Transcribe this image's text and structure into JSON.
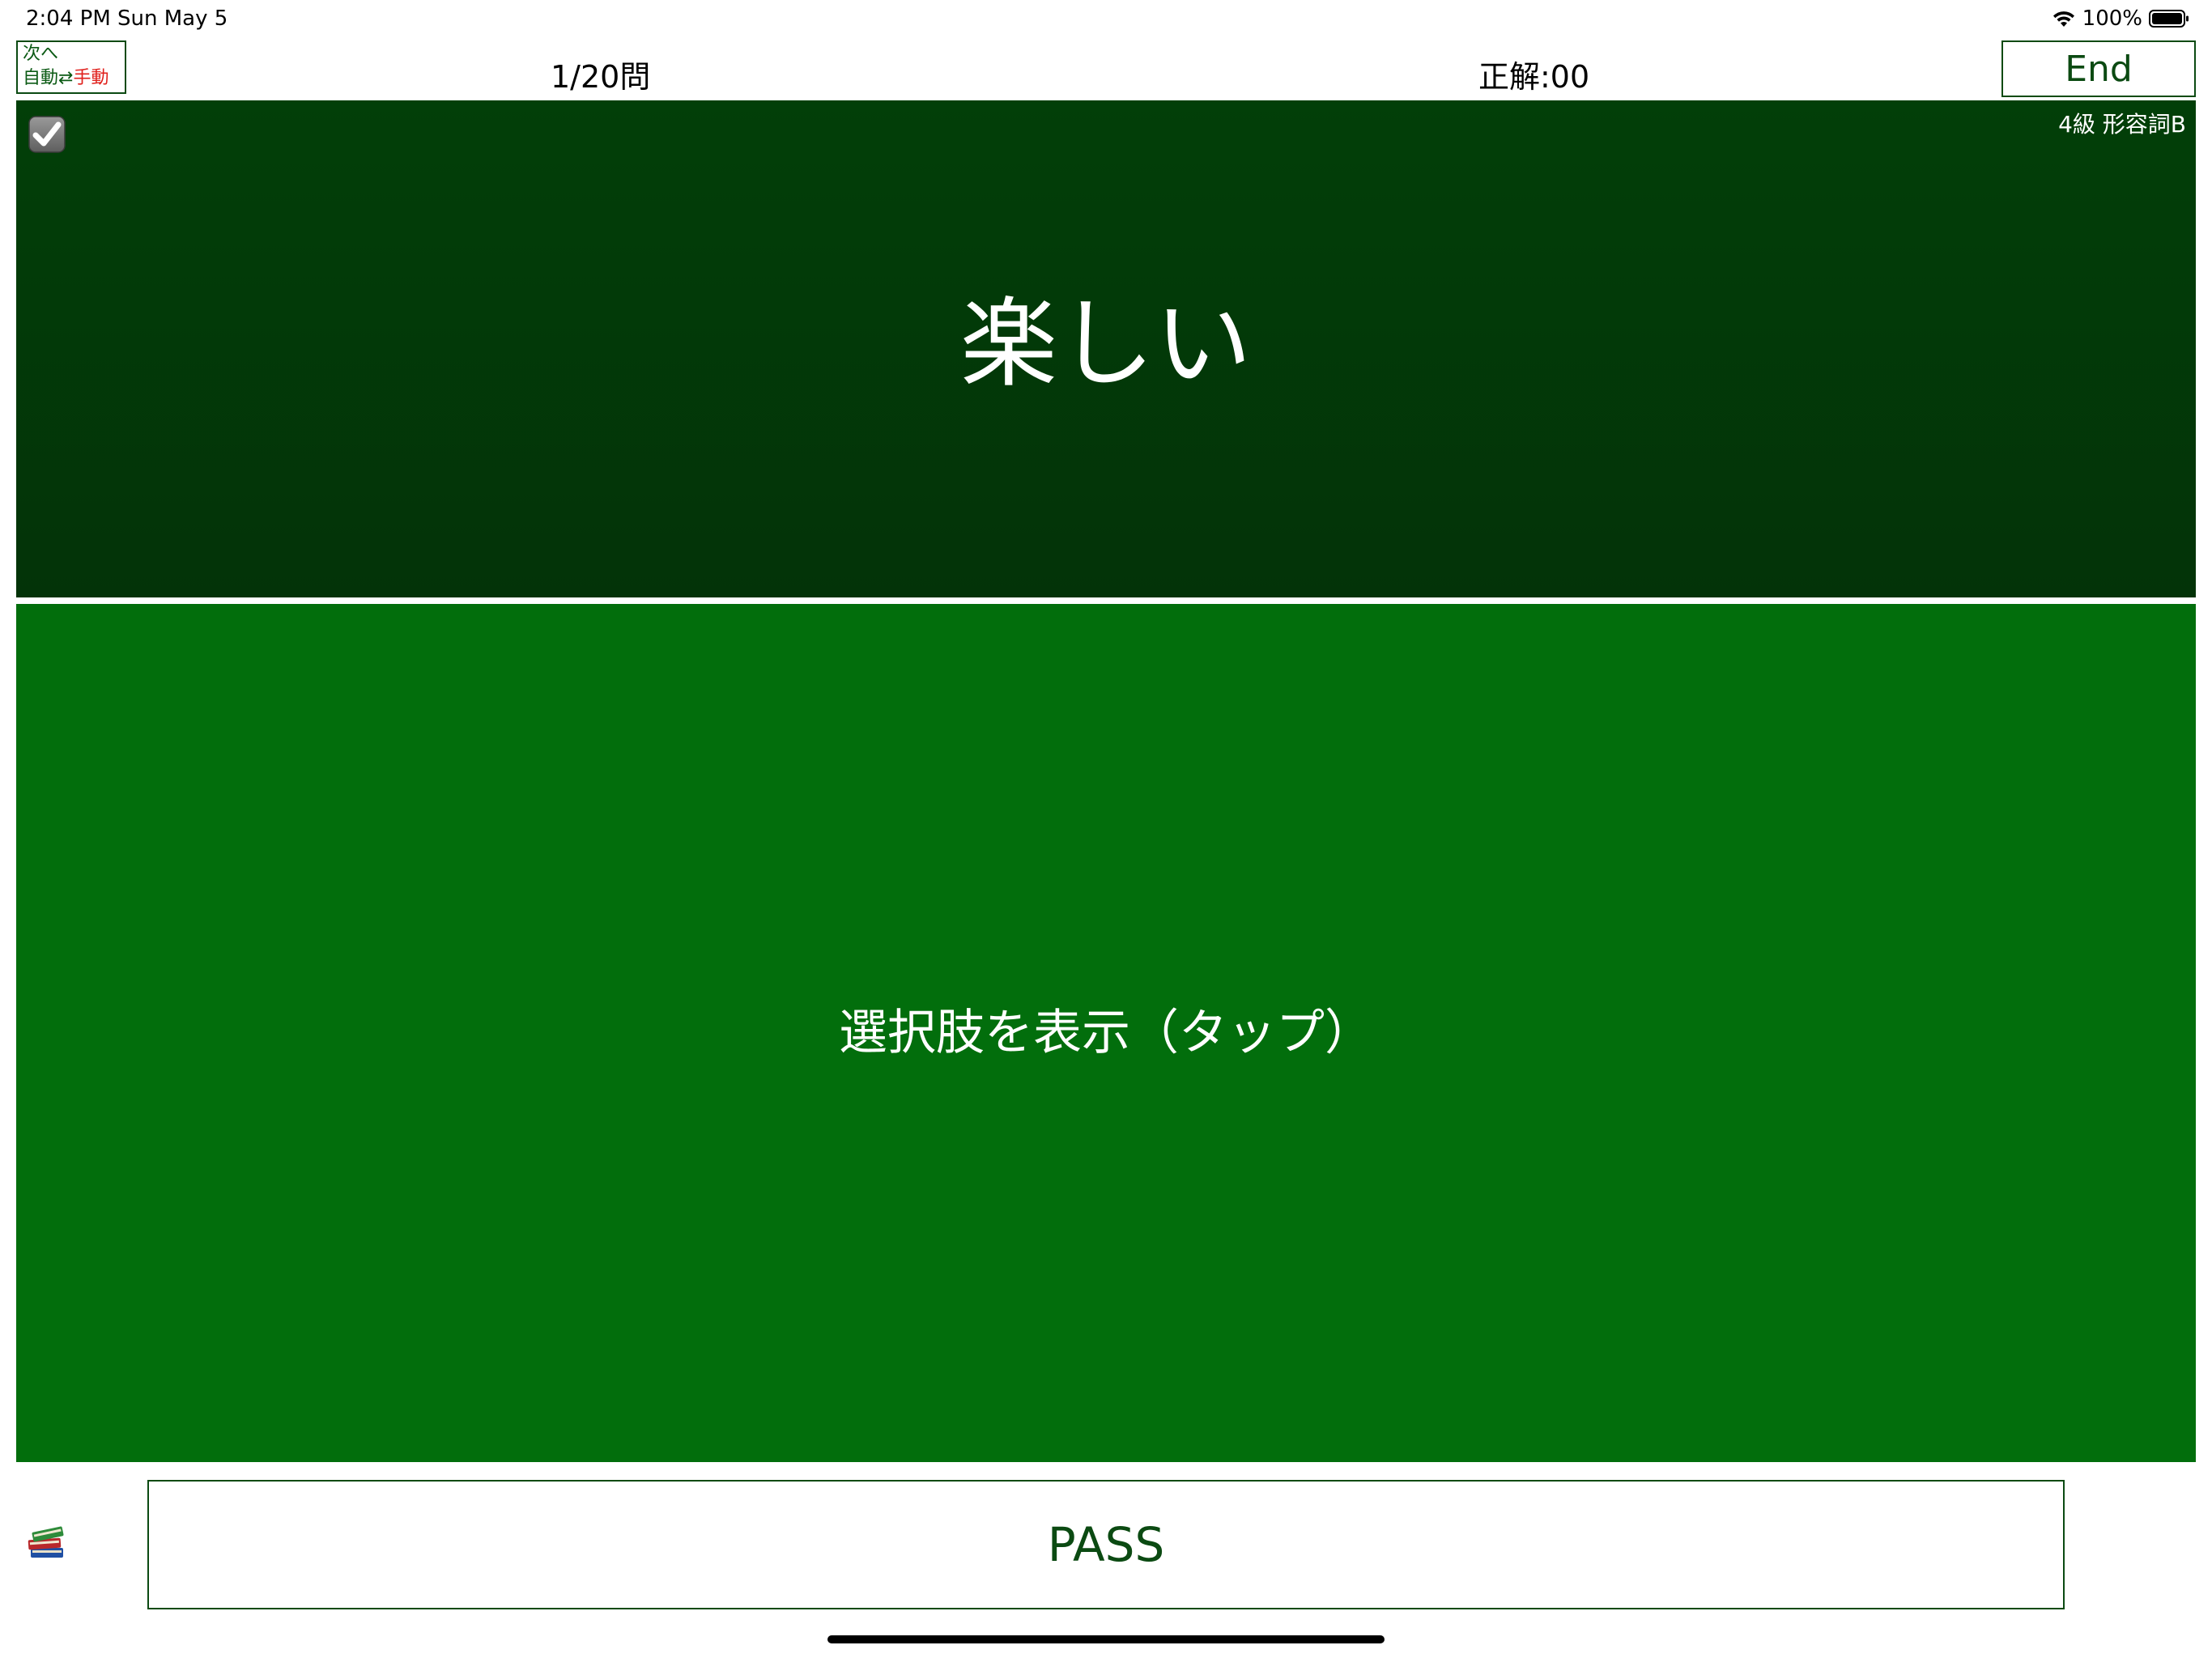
{
  "status_bar": {
    "time_date": "2:04 PM   Sun May 5",
    "battery_percent": "100%",
    "battery_level": 1.0
  },
  "toolbar": {
    "next_label": "次へ",
    "mode_auto": "自動",
    "mode_arrows": "⇄",
    "mode_manual": "手動",
    "question_counter": "1/20問",
    "correct_count": "正解:00",
    "end_label": "End"
  },
  "question": {
    "category": "4級 形容詞B",
    "word": "楽しい",
    "checked": true
  },
  "choices": {
    "prompt": "選択肢を表示（タップ）"
  },
  "bottom": {
    "pass_label": "PASS",
    "books_icon": "books-icon"
  },
  "colors": {
    "question_bg": "#023f08",
    "choices_bg": "#026e0c",
    "accent_green": "#0b4a12",
    "manual_red": "#e0201c"
  }
}
